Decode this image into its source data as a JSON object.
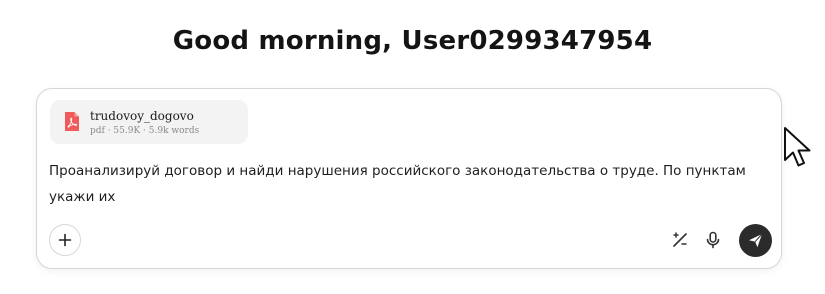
{
  "greeting": "Good morning, User0299347954",
  "attachment": {
    "file_name": "trudovoy_dogovo",
    "file_meta": "pdf · 55.9K · 5.9k words",
    "icon": "pdf-file-icon"
  },
  "prompt": {
    "text": "Проанализируй договор и найди нарушения российского законодательства о труде. По пунктам укажи их"
  },
  "toolbar": {
    "attach_icon": "plus-icon",
    "tools_icon": "percent-slash-icon",
    "mic_icon": "microphone-icon",
    "send_icon": "send-arrow-icon"
  },
  "colors": {
    "pdf_red": "#ef5a5a",
    "send_bg": "#2b2b2b",
    "chip_bg": "#f3f3f3",
    "border": "#d6d6d6"
  }
}
